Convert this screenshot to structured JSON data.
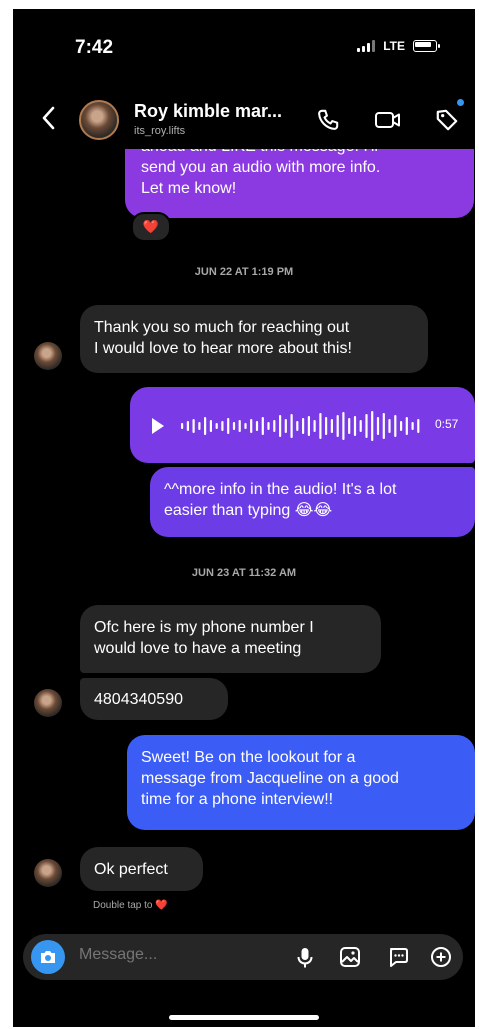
{
  "status_bar": {
    "time": "7:42",
    "network": "LTE"
  },
  "header": {
    "name": "Roy kimble mar...",
    "username": "its_roy.lifts",
    "icons": [
      "chevron-left-icon",
      "phone-icon",
      "video-camera-icon",
      "tag-icon"
    ]
  },
  "messages": {
    "m0_line1": "ahead and LIKE this message. I'll",
    "m0_line2": "send you an audio with more info.",
    "m0_line3": "Let me know!",
    "m0_reaction": "❤️",
    "ts1": "JUN 22 AT 1:19 PM",
    "m1_line1": "Thank you so much for reaching out",
    "m1_line2": "I would love to hear more about this!",
    "audio_duration": "0:57",
    "m3_line1": "^^more info in the audio! It's a lot",
    "m3_line2": "easier than typing 😂😂",
    "ts2": "JUN 23 AT 11:32 AM",
    "m4_line1": "Ofc here is my phone number I",
    "m4_line2": "would love to have a meeting",
    "m5": "4804340590",
    "m6_line1": "Sweet! Be on the lookout for a",
    "m6_line2": "message from Jacqueline on a good",
    "m6_line3": "time for a phone interview!!",
    "m7": "Ok perfect",
    "hint": "Double tap to ❤️"
  },
  "composer": {
    "placeholder": "Message...",
    "icons": [
      "camera-icon",
      "microphone-icon",
      "gallery-icon",
      "sticker-icon",
      "plus-icon"
    ]
  },
  "colors": {
    "incoming": "#262626",
    "outgoing_purple": "#8a3ae0",
    "outgoing_violet": "#6c3ce6",
    "outgoing_blue": "#3b5cf5",
    "accent": "#3797f0"
  }
}
